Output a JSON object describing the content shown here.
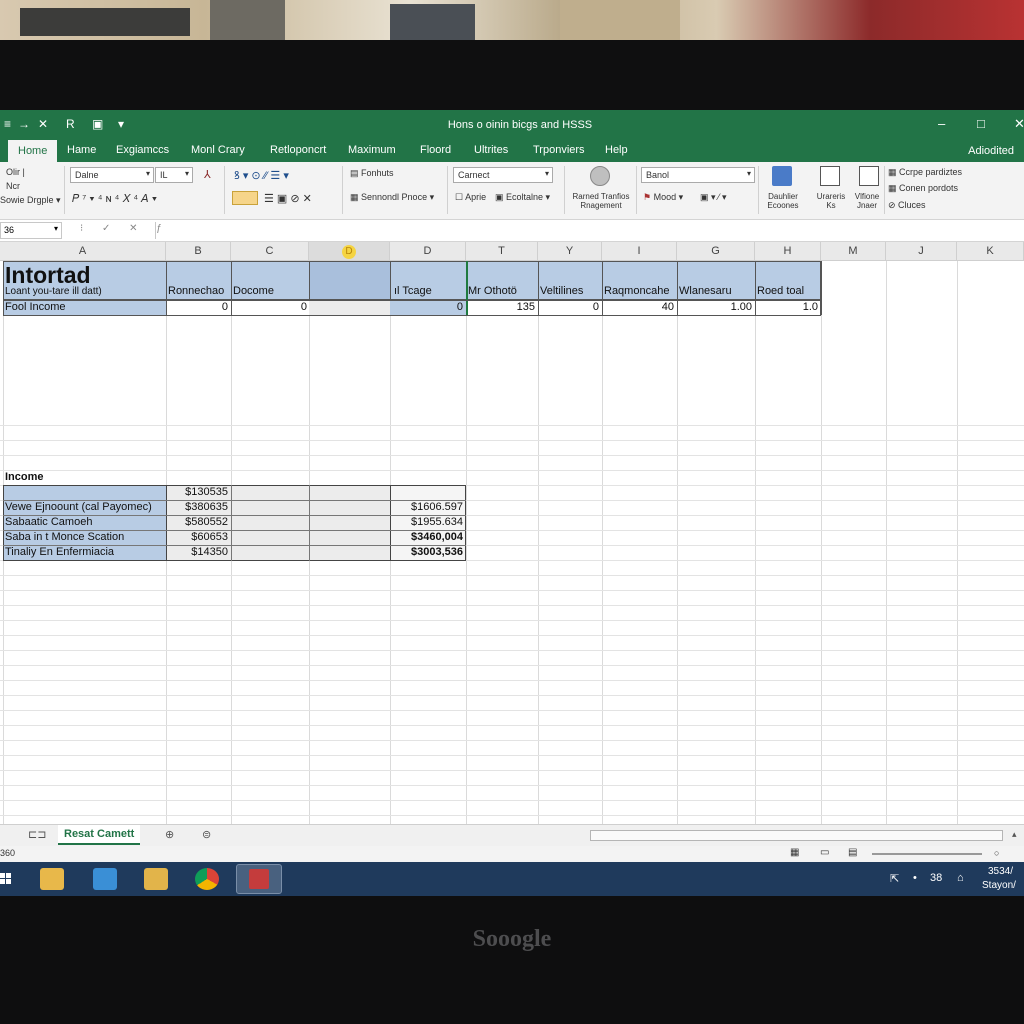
{
  "window": {
    "title": "Hons o oinin bicgs and HSSS",
    "quick_access": [
      "→",
      "✕",
      "R",
      "▣",
      "▾"
    ],
    "controls": [
      "–",
      "□",
      "✕"
    ]
  },
  "tabs": [
    "Home",
    "Hame",
    "Exgiamccs",
    "Monl Crary",
    "Retloponcrt",
    "Maximum",
    "Floord",
    "Ultrites",
    "Trponviers",
    "Help"
  ],
  "account": "Adiodited",
  "ribbon": {
    "clipboard": [
      "Olir |",
      "Ncr",
      "Sowie Drgple ▾"
    ],
    "font_name": "Dalne",
    "font_size": "IL",
    "styles": [
      "Fonhuts",
      "Sennondl Pnoce ▾"
    ],
    "number_format": "Carnect",
    "number_items": [
      "Aprie",
      "Ecoltalne ▾"
    ],
    "cond_label": "Rarned Tranfios Rnagement",
    "cells_combo": "Banol",
    "cells_items": [
      "Mood ▾"
    ],
    "editing": [
      "Dauhlier Ecoones",
      "Urareris Ks",
      "Vlfione Jnaer"
    ],
    "right_items": [
      "Ccrpe pardiztes",
      "Conen pordots",
      "Cluces"
    ]
  },
  "formula_bar": {
    "name_box": "36",
    "fx_icons": "⁝ ✓ ✕ ƒ"
  },
  "columns": [
    "A",
    "B",
    "C",
    "D",
    "D",
    "T",
    "Y",
    "I",
    "G",
    "H",
    "M",
    "J",
    "K"
  ],
  "rows": {
    "title": "Intortad",
    "subtitle": "Loant you-tare ill datt)",
    "headers": [
      "Ronnechao",
      "Docome",
      "",
      "ıl Tcage",
      "Mr Othotö",
      "Veltilines",
      "Raqmoncahe",
      "Wlanesaru",
      "Roed toal"
    ],
    "fool_income_label": "Fool Income",
    "fool_income_values": [
      "0",
      "0",
      "",
      "0",
      "135",
      "0",
      "40",
      "1.00",
      "1.0"
    ],
    "income_label": "Income",
    "income_table": [
      {
        "label": "",
        "b": "$130535",
        "d": ""
      },
      {
        "label": "Vewe Ejnoount (cal Payomec)",
        "b": "$380635",
        "d": "$1606.597"
      },
      {
        "label": "Sabaatic Camoeh",
        "b": "$580552",
        "d": "$1955.634"
      },
      {
        "label": "Saba in t Monce Scation",
        "b": "$60653",
        "d": "$3460,004"
      },
      {
        "label": "Tinaliy En Enfermiacia",
        "b": "$14350",
        "d": "$3003,536"
      }
    ]
  },
  "sheet_tabs": [
    "Resat",
    "Camett"
  ],
  "status": {
    "left": "360",
    "zoom_icon": "○"
  },
  "taskbar": {
    "tray": [
      "⇱",
      "•",
      "38",
      "⌂"
    ],
    "time": "3534/",
    "date": "Stayon/"
  },
  "device": {
    "brand": "Sooogle"
  },
  "colors": {
    "excel_green": "#227447",
    "header_blue": "#b8cce4",
    "taskbar": "#1f3a5c"
  }
}
